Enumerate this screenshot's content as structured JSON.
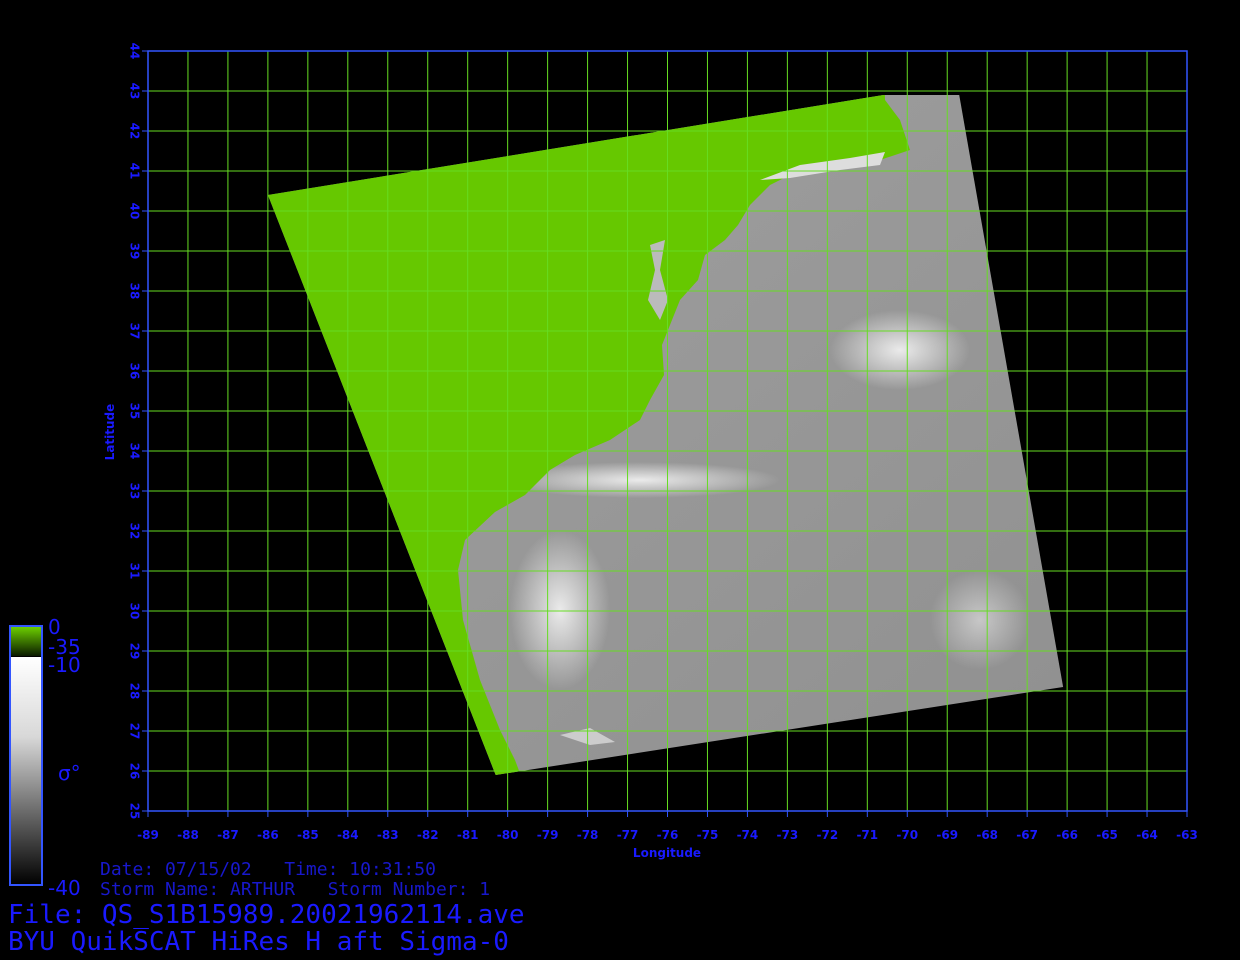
{
  "map": {
    "xaxis": {
      "label": "Longitude",
      "min": -89,
      "max": -63,
      "ticks": [
        -89,
        -88,
        -87,
        -86,
        -85,
        -84,
        -83,
        -82,
        -81,
        -80,
        -79,
        -78,
        -77,
        -76,
        -75,
        -74,
        -73,
        -72,
        -71,
        -70,
        -69,
        -68,
        -67,
        -66,
        -65,
        -64,
        -63
      ]
    },
    "yaxis": {
      "label": "Latitude",
      "min": 25,
      "max": 44,
      "ticks": [
        25,
        26,
        27,
        28,
        29,
        30,
        31,
        32,
        33,
        34,
        35,
        36,
        37,
        38,
        39,
        40,
        41,
        42,
        43,
        44
      ]
    },
    "grid": true,
    "colors": {
      "background": "#000000",
      "grid": "#66dd22",
      "axis": "#3355ff",
      "text": "#1a1aff",
      "land": "#66c800"
    },
    "swath_corners_lonlat": [
      [
        -86.0,
        40.4
      ],
      [
        -70.6,
        42.9
      ],
      [
        -68.7,
        42.9
      ],
      [
        -66.1,
        28.1
      ],
      [
        -80.3,
        25.9
      ]
    ],
    "colorbar": {
      "label": "σ°",
      "land_range": {
        "top": "0",
        "bottom": "-35"
      },
      "sigma_range": {
        "top": "-10",
        "bottom": "-40"
      }
    }
  },
  "info": {
    "date_line": "Date: 07/15/02   Time: 10:31:50",
    "storm_line": "Storm Name: ARTHUR   Storm Number: 1",
    "file_line": "File: QS_S1B15989.20021962114.ave",
    "title_line": "BYU QuikSCAT HiRes H aft Sigma-0"
  }
}
